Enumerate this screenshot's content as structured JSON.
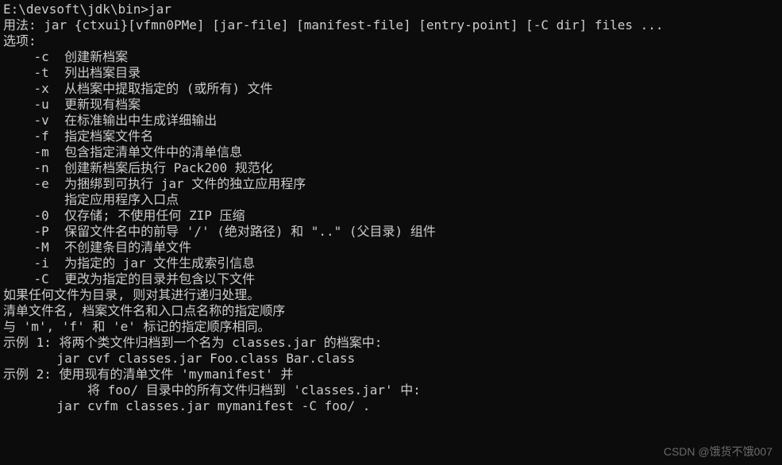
{
  "prompt_line": "E:\\devsoft\\jdk\\bin>jar",
  "usage_line": "用法: jar {ctxui}[vfmn0PMe] [jar-file] [manifest-file] [entry-point] [-C dir] files ...",
  "options_header": "选项:",
  "options": {
    "c": "    -c  创建新档案",
    "t": "    -t  列出档案目录",
    "x": "    -x  从档案中提取指定的 (或所有) 文件",
    "u": "    -u  更新现有档案",
    "v": "    -v  在标准输出中生成详细输出",
    "f": "    -f  指定档案文件名",
    "m": "    -m  包含指定清单文件中的清单信息",
    "n": "    -n  创建新档案后执行 Pack200 规范化",
    "e1": "    -e  为捆绑到可执行 jar 文件的独立应用程序",
    "e2": "        指定应用程序入口点",
    "0": "    -0  仅存储; 不使用任何 ZIP 压缩",
    "P": "    -P  保留文件名中的前导 '/' (绝对路径) 和 \"..\" (父目录) 组件",
    "M": "    -M  不创建条目的清单文件",
    "i": "    -i  为指定的 jar 文件生成索引信息",
    "C": "    -C  更改为指定的目录并包含以下文件"
  },
  "notes": {
    "n1": "如果任何文件为目录, 则对其进行递归处理。",
    "n2": "清单文件名, 档案文件名和入口点名称的指定顺序",
    "n3": "与 'm', 'f' 和 'e' 标记的指定顺序相同。"
  },
  "blank": "",
  "examples": {
    "ex1_desc": "示例 1: 将两个类文件归档到一个名为 classes.jar 的档案中:",
    "ex1_cmd": "       jar cvf classes.jar Foo.class Bar.class",
    "ex2_desc": "示例 2: 使用现有的清单文件 'mymanifest' 并",
    "ex2_cont": "           将 foo/ 目录中的所有文件归档到 'classes.jar' 中:",
    "ex2_cmd": "       jar cvfm classes.jar mymanifest -C foo/ ."
  },
  "watermark": "CSDN @饿货不饿007"
}
